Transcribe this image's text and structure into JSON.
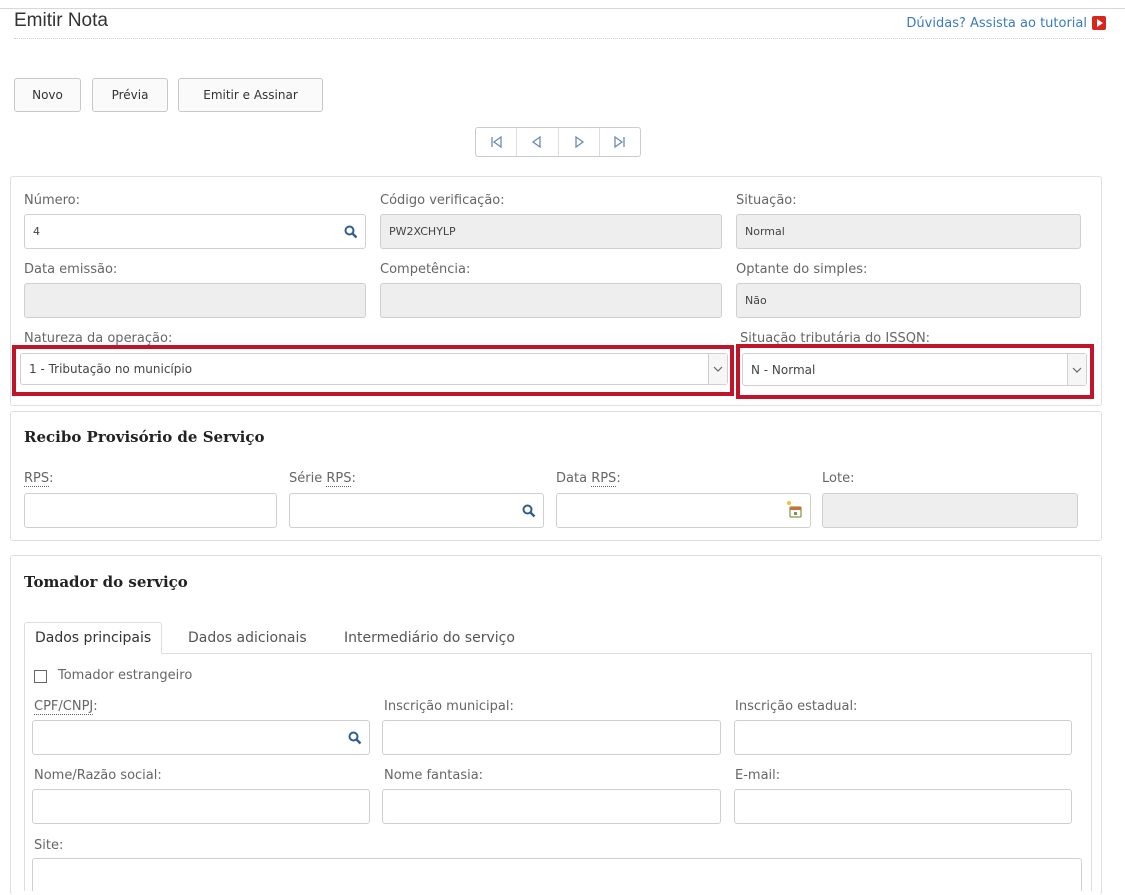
{
  "header": {
    "title": "Emitir Nota",
    "tutorial_link": "Dúvidas? Assista ao tutorial"
  },
  "toolbar": {
    "novo": "Novo",
    "previa": "Prévia",
    "emitir": "Emitir e Assinar"
  },
  "pager_icons": [
    "first-record-icon",
    "previous-record-icon",
    "next-record-icon",
    "last-record-icon"
  ],
  "nota": {
    "numero_label": "Número:",
    "numero_value": "4",
    "codigo_label": "Código verificação:",
    "codigo_value": "PW2XCHYLP",
    "situacao_label": "Situação:",
    "situacao_value": "Normal",
    "data_emissao_label": "Data emissão:",
    "competencia_label": "Competência:",
    "optante_label": "Optante do simples:",
    "optante_value": "Não",
    "natureza_label": "Natureza da operação:",
    "natureza_value": "1 - Tributação no município",
    "situacao_trib_label": "Situação tributária do ISSQN:",
    "situacao_trib_value": "N - Normal"
  },
  "rps": {
    "title": "Recibo Provisório de Serviço",
    "rps_label_abbr": "RPS",
    "serie_label_prefix": "Série ",
    "serie_label_abbr": "RPS",
    "data_label_prefix": "Data ",
    "data_label_abbr": "RPS",
    "label_suffix": ":",
    "lote_label": "Lote:"
  },
  "tomador": {
    "title": "Tomador do serviço",
    "tabs": [
      "Dados principais",
      "Dados adicionais",
      "Intermediário do serviço"
    ],
    "estrangeiro_label": "Tomador estrangeiro",
    "cpf_label_abbr": "CPF/CNPJ",
    "inscricao_municipal_label": "Inscrição municipal:",
    "inscricao_estadual_label": "Inscrição estadual:",
    "nome_label": "Nome/Razão social:",
    "fantasia_label": "Nome fantasia:",
    "email_label": "E-mail:",
    "site_label": "Site:"
  },
  "colors": {
    "highlight": "#c0142a",
    "link": "#3a7bbf",
    "readonly_bg": "#eeeeee"
  }
}
